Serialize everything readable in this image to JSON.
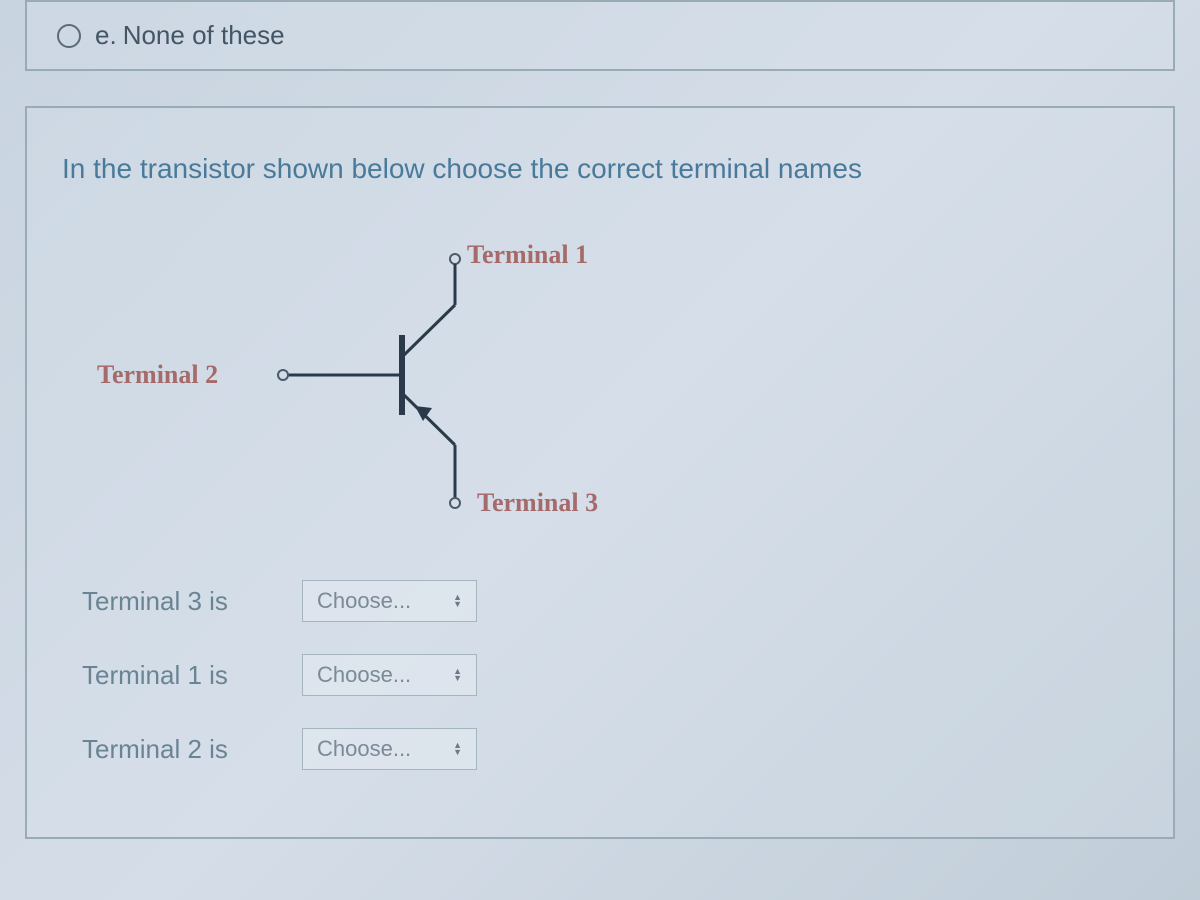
{
  "prev_question": {
    "option_e": {
      "letter": "e.",
      "text": "None of these"
    }
  },
  "question": {
    "prompt": "In the transistor shown below choose the correct terminal names",
    "diagram": {
      "terminal1": "Terminal 1",
      "terminal2": "Terminal 2",
      "terminal3": "Terminal 3"
    },
    "answers": [
      {
        "label": "Terminal 3 is",
        "select": "Choose..."
      },
      {
        "label": "Terminal 1 is",
        "select": "Choose..."
      },
      {
        "label": "Terminal 2 is",
        "select": "Choose..."
      }
    ]
  }
}
